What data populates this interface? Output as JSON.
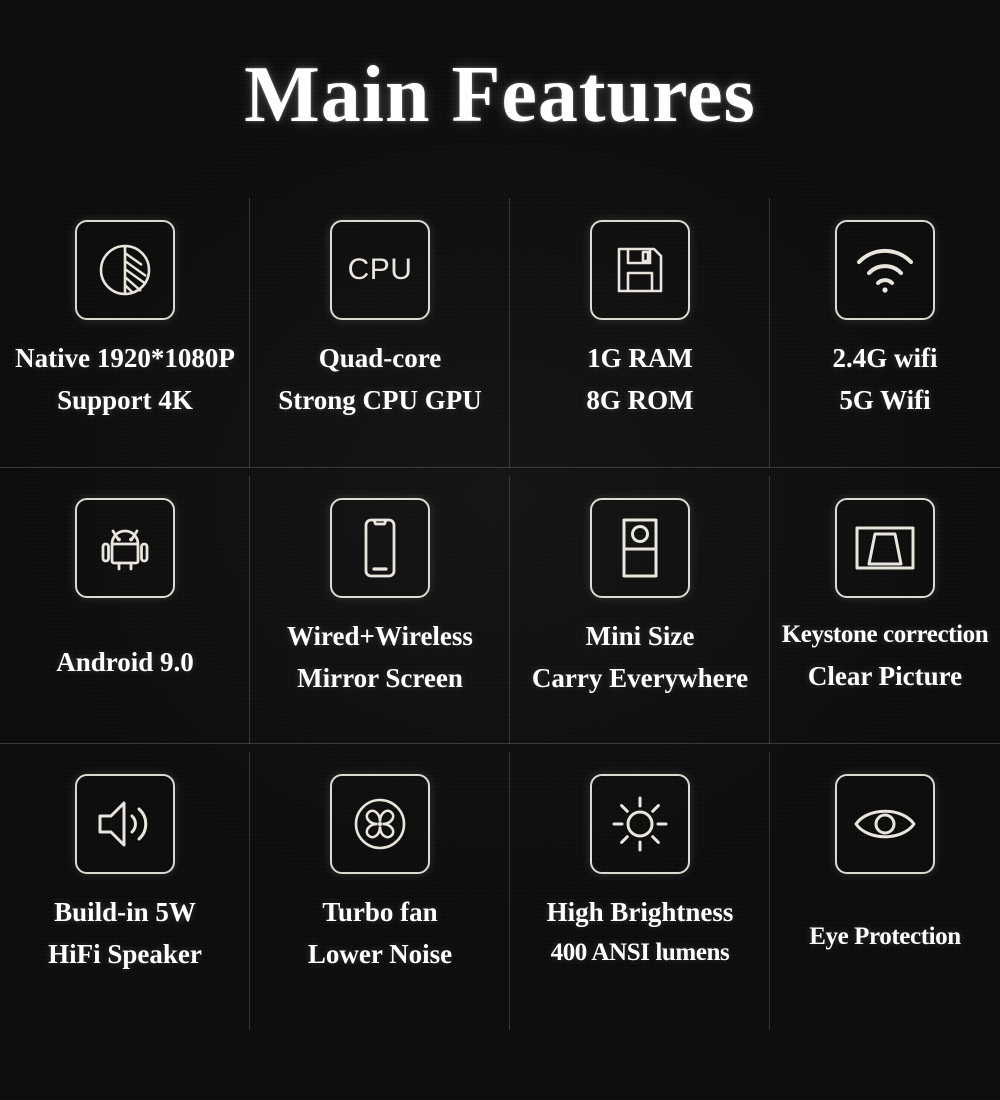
{
  "page": {
    "title": "Main Features",
    "background_color": "#0c0c0c",
    "text_color": "#ffffff",
    "icon_stroke_color": "#ddd9d0"
  },
  "features": [
    {
      "icon": "contrast-resolution-icon",
      "line1": "Native 1920*1080P",
      "line2": "Support 4K"
    },
    {
      "icon": "cpu-icon",
      "icon_text": "CPU",
      "line1": "Quad-core",
      "line2": "Strong CPU GPU"
    },
    {
      "icon": "floppy-disk-storage-icon",
      "line1": "1G RAM",
      "line2": "8G ROM"
    },
    {
      "icon": "wifi-icon",
      "line1": "2.4G wifi",
      "line2": "5G Wifi"
    },
    {
      "icon": "android-robot-icon",
      "line1": "Android 9.0",
      "line2": ""
    },
    {
      "icon": "smartphone-mirror-icon",
      "line1": "Wired+Wireless",
      "line2": "Mirror Screen"
    },
    {
      "icon": "mini-projector-icon",
      "line1": "Mini Size",
      "line2": "Carry Everywhere"
    },
    {
      "icon": "keystone-trapezoid-icon",
      "line1": "Keystone correction",
      "line2": "Clear Picture"
    },
    {
      "icon": "speaker-volume-icon",
      "line1": "Build-in 5W",
      "line2": "HiFi Speaker"
    },
    {
      "icon": "fan-icon",
      "line1": "Turbo fan",
      "line2": "Lower Noise"
    },
    {
      "icon": "brightness-sun-icon",
      "line1": "High Brightness",
      "line2": "400 ANSI lumens"
    },
    {
      "icon": "eye-protection-icon",
      "line1": "Eye Protection",
      "line2": ""
    }
  ]
}
